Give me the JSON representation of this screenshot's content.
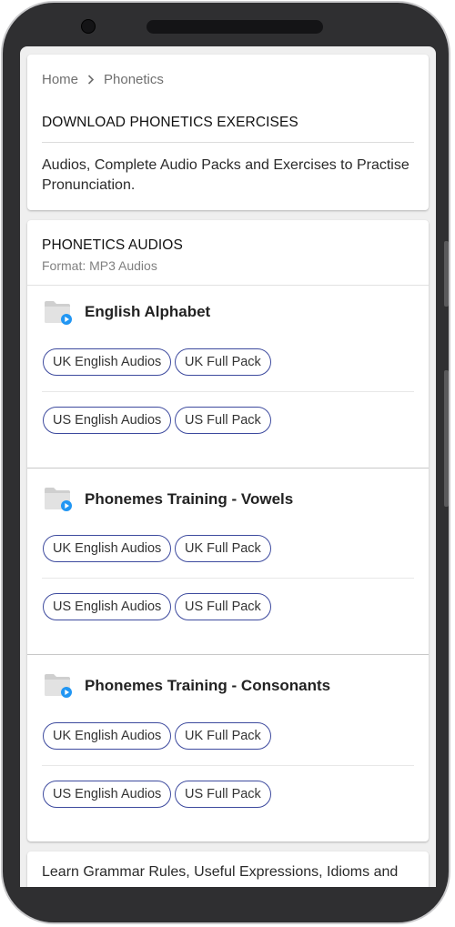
{
  "breadcrumb": {
    "home": "Home",
    "current": "Phonetics"
  },
  "intro": {
    "title": "DOWNLOAD PHONETICS EXERCISES",
    "description": "Audios, Complete Audio Packs and Exercises to Practise Pronunciation."
  },
  "audios": {
    "title": "PHONETICS AUDIOS",
    "format": "Format: MP3 Audios",
    "sections": [
      {
        "title": "English Alphabet",
        "uk_audios": "UK English Audios",
        "uk_pack": "UK Full Pack",
        "us_audios": "US English Audios",
        "us_pack": "US Full Pack"
      },
      {
        "title": "Phonemes Training - Vowels",
        "uk_audios": "UK English Audios",
        "uk_pack": "UK Full Pack",
        "us_audios": "US English Audios",
        "us_pack": "US Full Pack"
      },
      {
        "title": "Phonemes Training - Consonants",
        "uk_audios": "UK English Audios",
        "uk_pack": "UK Full Pack",
        "us_audios": "US English Audios",
        "us_pack": "US Full Pack"
      }
    ]
  },
  "footer": {
    "text": "Learn Grammar Rules, Useful Expressions, Idioms and"
  },
  "colors": {
    "accent": "#3d4a9e",
    "play_badge": "#2196f3",
    "folder": "#d6d6d6"
  }
}
